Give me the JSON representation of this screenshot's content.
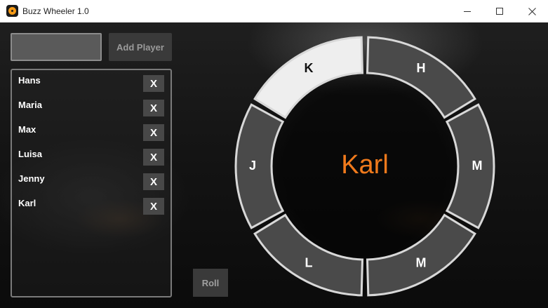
{
  "window": {
    "title": "Buzz Wheeler 1.0"
  },
  "controls": {
    "name_input_value": "",
    "add_player_label": "Add Player",
    "roll_label": "Roll"
  },
  "players": [
    {
      "name": "Hans",
      "remove_label": "X"
    },
    {
      "name": "Maria",
      "remove_label": "X"
    },
    {
      "name": "Max",
      "remove_label": "X"
    },
    {
      "name": "Luisa",
      "remove_label": "X"
    },
    {
      "name": "Jenny",
      "remove_label": "X"
    },
    {
      "name": "Karl",
      "remove_label": "X"
    }
  ],
  "wheel": {
    "segments": [
      {
        "letter": "K",
        "selected": true
      },
      {
        "letter": "H",
        "selected": false
      },
      {
        "letter": "M",
        "selected": false
      },
      {
        "letter": "M",
        "selected": false
      },
      {
        "letter": "L",
        "selected": false
      },
      {
        "letter": "J",
        "selected": false
      }
    ],
    "winner": "Karl"
  },
  "colors": {
    "winner": "#f07a1c",
    "segment_fill": "#4a4a4a",
    "segment_selected_fill": "#eeeeee",
    "segment_stroke": "#d8d8d8"
  },
  "icons": {
    "app": "app-logo-icon",
    "minimize": "minimize-icon",
    "maximize": "maximize-icon",
    "close": "close-icon"
  }
}
